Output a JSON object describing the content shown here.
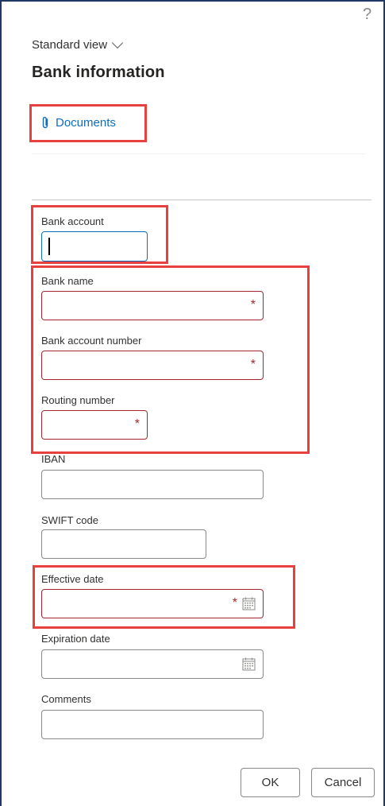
{
  "header": {
    "help_glyph": "?",
    "view_selector_label": "Standard view",
    "title": "Bank information"
  },
  "actions": {
    "documents_label": "Documents"
  },
  "form": {
    "bank_account": {
      "label": "Bank account",
      "value": ""
    },
    "bank_name": {
      "label": "Bank name",
      "value": "",
      "required": true
    },
    "bank_account_number": {
      "label": "Bank account number",
      "value": "",
      "required": true
    },
    "routing_number": {
      "label": "Routing number",
      "value": "",
      "required": true
    },
    "iban": {
      "label": "IBAN",
      "value": ""
    },
    "swift_code": {
      "label": "SWIFT code",
      "value": ""
    },
    "effective_date": {
      "label": "Effective date",
      "value": "",
      "required": true
    },
    "expiration_date": {
      "label": "Expiration date",
      "value": ""
    },
    "comments": {
      "label": "Comments",
      "value": ""
    },
    "required_marker": "*"
  },
  "footer": {
    "ok_label": "OK",
    "cancel_label": "Cancel"
  },
  "colors": {
    "accent": "#0f6cbd",
    "required": "#a4262c",
    "highlight": "#e8403e",
    "frame": "#1f3864"
  },
  "icons": [
    "help-icon",
    "chevron-down-icon",
    "paperclip-icon",
    "calendar-icon"
  ]
}
